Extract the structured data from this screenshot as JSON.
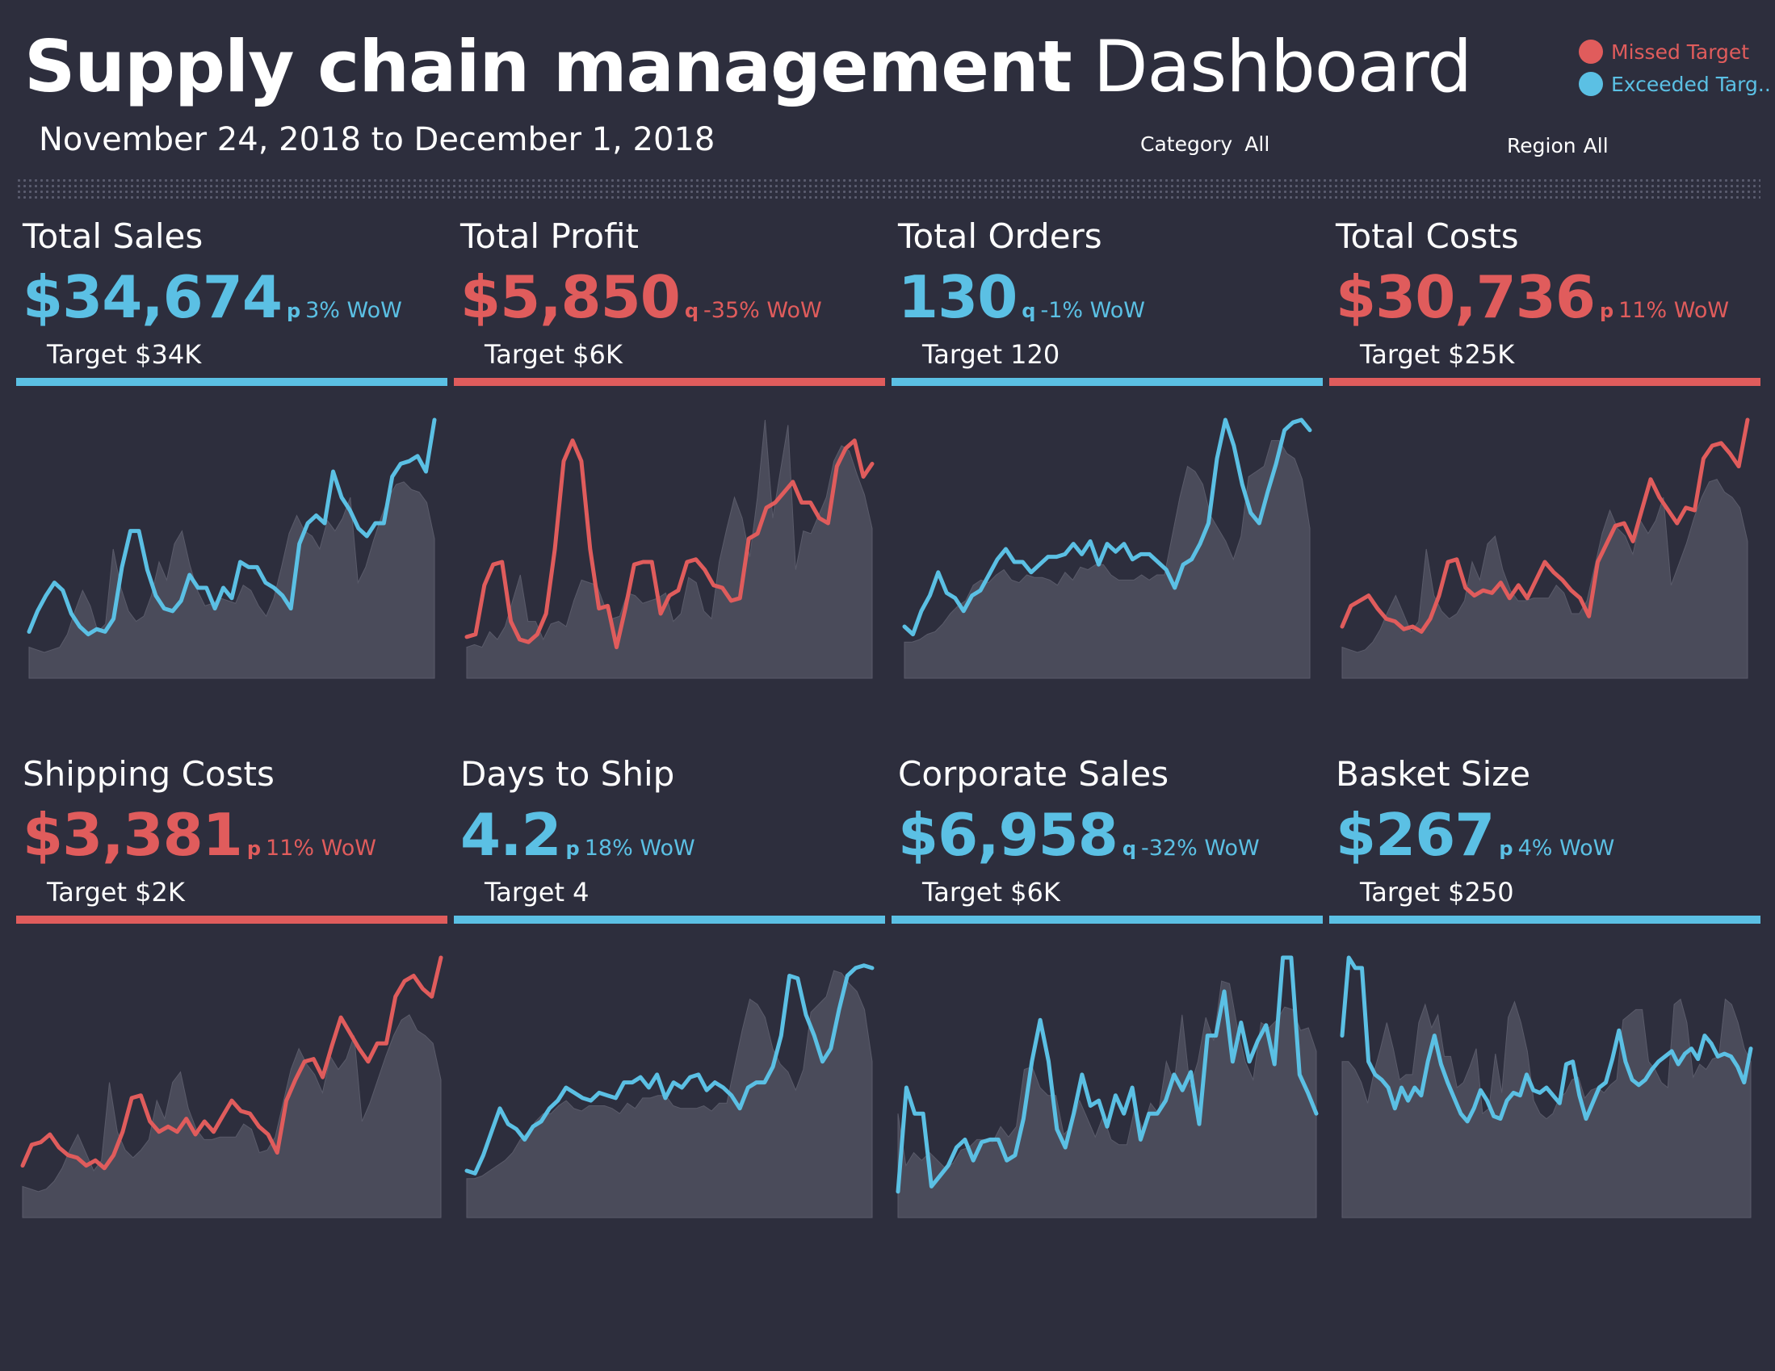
{
  "header": {
    "title_bold": "Supply chain management",
    "title_light": "Dashboard",
    "date_range": "November 24, 2018 to December 1, 2018",
    "category_label": "Category",
    "category_value": "All",
    "region_label": "Region",
    "region_value": "All"
  },
  "legend": [
    {
      "label": "Missed Target",
      "color": "#e05c5c"
    },
    {
      "label": "Exceeded Targ..",
      "color": "#5bc0e4"
    }
  ],
  "colors": {
    "missed": "#e05c5c",
    "exceeded": "#5bc0e4",
    "area": "#4a4b5a",
    "background": "#2d2e3d"
  },
  "kpis": [
    {
      "title": "Total Sales",
      "value": "$34,674",
      "arrow": "p",
      "change": "3% WoW",
      "target": "Target $34K",
      "status": "exceeded"
    },
    {
      "title": "Total Profit",
      "value": "$5,850",
      "arrow": "q",
      "change": "-35% WoW",
      "target": "Target $6K",
      "status": "missed"
    },
    {
      "title": "Total Orders",
      "value": "130",
      "arrow": "q",
      "change": "-1% WoW",
      "target": "Target 120",
      "status": "exceeded"
    },
    {
      "title": "Total Costs",
      "value": "$30,736",
      "arrow": "p",
      "change": "11% WoW",
      "target": "Target $25K",
      "status": "missed"
    },
    {
      "title": "Shipping Costs",
      "value": "$3,381",
      "arrow": "p",
      "change": "11% WoW",
      "target": "Target $2K",
      "status": "missed"
    },
    {
      "title": "Days to Ship",
      "value": "4.2",
      "arrow": "p",
      "change": "18% WoW",
      "target": "Target 4",
      "status": "exceeded"
    },
    {
      "title": "Corporate Sales",
      "value": "$6,958",
      "arrow": "q",
      "change": "-32% WoW",
      "target": "Target $6K",
      "status": "exceeded"
    },
    {
      "title": "Basket Size",
      "value": "$267",
      "arrow": "p",
      "change": "4% WoW",
      "target": "Target $250",
      "status": "exceeded"
    }
  ],
  "chart_data": [
    {
      "type": "line",
      "kpi": "Total Sales",
      "status": "exceeded",
      "line": [
        18,
        26,
        32,
        37,
        34,
        25,
        20,
        17,
        19,
        18,
        23,
        43,
        57,
        57,
        42,
        32,
        27,
        26,
        30,
        40,
        35,
        35,
        27,
        35,
        31,
        45,
        43,
        43,
        37,
        35,
        32,
        27,
        52,
        60,
        63,
        60,
        80,
        70,
        65,
        58,
        55,
        60,
        60,
        78,
        83,
        84,
        86,
        80,
        100
      ],
      "area": [
        12,
        11,
        10,
        11,
        12,
        17,
        26,
        34,
        28,
        18,
        21,
        50,
        35,
        26,
        22,
        24,
        32,
        45,
        38,
        52,
        57,
        44,
        34,
        28,
        29,
        31,
        30,
        29,
        36,
        34,
        28,
        24,
        31,
        43,
        56,
        63,
        57,
        55,
        50,
        61,
        57,
        62,
        70,
        37,
        43,
        53,
        62,
        70,
        75,
        76,
        73,
        72,
        68,
        54
      ]
    },
    {
      "type": "line",
      "kpi": "Total Profit",
      "status": "missed",
      "line": [
        16,
        17,
        36,
        44,
        45,
        22,
        15,
        14,
        17,
        25,
        50,
        84,
        92,
        84,
        50,
        27,
        28,
        12,
        27,
        44,
        45,
        45,
        25,
        32,
        34,
        45,
        46,
        42,
        36,
        35,
        30,
        31,
        54,
        56,
        66,
        68,
        72,
        76,
        68,
        68,
        62,
        60,
        82,
        89,
        92,
        78,
        83
      ],
      "area": [
        12,
        13,
        12,
        18,
        15,
        20,
        30,
        40,
        22,
        22,
        15,
        21,
        22,
        20,
        30,
        38,
        37,
        36,
        28,
        23,
        24,
        33,
        32,
        29,
        30,
        31,
        33,
        22,
        25,
        39,
        37,
        26,
        23,
        45,
        58,
        70,
        62,
        47,
        70,
        100,
        62,
        80,
        98,
        42,
        57,
        56,
        63,
        70,
        84,
        90,
        88,
        79,
        71,
        58
      ]
    },
    {
      "type": "line",
      "kpi": "Total Orders",
      "status": "exceeded",
      "line": [
        20,
        17,
        26,
        32,
        41,
        33,
        31,
        26,
        32,
        34,
        40,
        46,
        50,
        45,
        45,
        41,
        44,
        47,
        47,
        48,
        52,
        48,
        53,
        44,
        52,
        49,
        52,
        46,
        48,
        48,
        45,
        42,
        35,
        44,
        46,
        52,
        60,
        85,
        100,
        90,
        75,
        64,
        60,
        72,
        83,
        96,
        99,
        100,
        96
      ],
      "area": [
        14,
        14,
        15,
        17,
        18,
        21,
        25,
        28,
        30,
        36,
        38,
        37,
        40,
        42,
        38,
        37,
        40,
        39,
        39,
        38,
        36,
        41,
        38,
        43,
        42,
        44,
        44,
        40,
        38,
        38,
        38,
        40,
        38,
        40,
        40,
        55,
        70,
        82,
        80,
        75,
        63,
        58,
        53,
        46,
        55,
        78,
        80,
        82,
        92,
        92,
        87,
        85,
        77,
        58
      ]
    },
    {
      "type": "line",
      "kpi": "Total Costs",
      "status": "missed",
      "line": [
        20,
        28,
        30,
        32,
        27,
        23,
        22,
        19,
        20,
        18,
        23,
        32,
        45,
        46,
        35,
        32,
        34,
        33,
        37,
        31,
        36,
        31,
        38,
        45,
        41,
        38,
        34,
        31,
        24,
        45,
        52,
        59,
        60,
        53,
        65,
        77,
        70,
        65,
        60,
        66,
        65,
        85,
        90,
        91,
        87,
        82,
        100
      ],
      "area": [
        12,
        11,
        10,
        11,
        14,
        19,
        26,
        32,
        25,
        18,
        22,
        50,
        32,
        26,
        23,
        25,
        30,
        45,
        38,
        52,
        55,
        42,
        34,
        30,
        30,
        31,
        31,
        31,
        36,
        33,
        25,
        25,
        30,
        43,
        56,
        65,
        58,
        55,
        48,
        61,
        56,
        61,
        70,
        36,
        44,
        52,
        62,
        70,
        76,
        77,
        72,
        70,
        66,
        53
      ]
    },
    {
      "type": "line",
      "kpi": "Shipping Costs",
      "status": "missed",
      "line": [
        20,
        28,
        29,
        32,
        27,
        24,
        23,
        20,
        22,
        19,
        24,
        33,
        46,
        47,
        37,
        33,
        35,
        33,
        38,
        32,
        37,
        33,
        39,
        45,
        41,
        40,
        35,
        32,
        25,
        45,
        53,
        60,
        61,
        54,
        66,
        77,
        71,
        65,
        60,
        67,
        67,
        85,
        91,
        93,
        88,
        85,
        100
      ],
      "area": [
        12,
        11,
        10,
        11,
        14,
        19,
        26,
        32,
        25,
        18,
        22,
        52,
        33,
        26,
        23,
        26,
        30,
        45,
        38,
        52,
        56,
        42,
        34,
        30,
        30,
        31,
        31,
        31,
        36,
        34,
        25,
        26,
        31,
        44,
        57,
        65,
        59,
        55,
        48,
        62,
        57,
        61,
        70,
        37,
        44,
        53,
        62,
        70,
        76,
        78,
        72,
        70,
        67,
        53
      ]
    },
    {
      "type": "line",
      "kpi": "Days to Ship",
      "status": "exceeded",
      "line": [
        18,
        17,
        24,
        33,
        42,
        36,
        34,
        30,
        35,
        37,
        42,
        45,
        50,
        48,
        46,
        45,
        48,
        47,
        46,
        52,
        52,
        54,
        50,
        55,
        46,
        52,
        50,
        54,
        55,
        49,
        52,
        50,
        47,
        42,
        50,
        52,
        52,
        58,
        70,
        93,
        92,
        78,
        70,
        60,
        65,
        80,
        93,
        96,
        97,
        96
      ],
      "area": [
        15,
        15,
        16,
        18,
        20,
        22,
        25,
        30,
        33,
        37,
        40,
        40,
        43,
        45,
        42,
        41,
        43,
        43,
        43,
        42,
        40,
        44,
        42,
        46,
        46,
        47,
        47,
        43,
        42,
        42,
        42,
        43,
        41,
        44,
        44,
        58,
        72,
        84,
        82,
        77,
        65,
        59,
        56,
        49,
        57,
        79,
        82,
        85,
        95,
        94,
        90,
        87,
        80,
        60
      ]
    },
    {
      "type": "line",
      "kpi": "Corporate Sales",
      "status": "exceeded",
      "line": [
        10,
        50,
        40,
        40,
        12,
        16,
        20,
        27,
        30,
        22,
        29,
        30,
        30,
        22,
        24,
        38,
        60,
        76,
        60,
        34,
        27,
        40,
        55,
        43,
        45,
        35,
        47,
        40,
        50,
        30,
        40,
        40,
        45,
        55,
        49,
        56,
        36,
        70,
        70,
        87,
        60,
        75,
        60,
        68,
        74,
        59,
        100,
        100,
        55,
        48,
        40
      ],
      "area": [
        40,
        20,
        25,
        22,
        25,
        22,
        19,
        21,
        26,
        27,
        30,
        30,
        29,
        35,
        31,
        35,
        57,
        58,
        50,
        47,
        47,
        32,
        35,
        45,
        38,
        31,
        39,
        30,
        28,
        28,
        42,
        34,
        44,
        40,
        60,
        52,
        78,
        50,
        60,
        77,
        68,
        91,
        90,
        73,
        60,
        53,
        75,
        73,
        76,
        81,
        80,
        72,
        73,
        64
      ]
    },
    {
      "type": "line",
      "kpi": "Basket Size",
      "status": "exceeded",
      "line": [
        70,
        100,
        96,
        96,
        60,
        55,
        53,
        50,
        42,
        50,
        45,
        50,
        47,
        60,
        70,
        59,
        52,
        46,
        40,
        37,
        42,
        49,
        45,
        39,
        38,
        45,
        48,
        47,
        55,
        49,
        48,
        50,
        47,
        44,
        59,
        60,
        47,
        38,
        44,
        50,
        52,
        61,
        72,
        60,
        53,
        51,
        53,
        57,
        60,
        62,
        64,
        59,
        63,
        65,
        61,
        70,
        67,
        62,
        63,
        62,
        58,
        52,
        65
      ],
      "area": [
        60,
        60,
        57,
        52,
        44,
        56,
        65,
        75,
        65,
        53,
        55,
        55,
        75,
        82,
        73,
        78,
        62,
        62,
        50,
        52,
        58,
        65,
        40,
        42,
        63,
        48,
        77,
        83,
        75,
        64,
        45,
        40,
        38,
        40,
        46,
        48,
        53,
        54,
        46,
        49,
        50,
        48,
        51,
        53,
        76,
        78,
        80,
        80,
        60,
        57,
        52,
        50,
        82,
        84,
        75,
        54,
        59,
        57,
        61,
        62,
        84,
        82,
        75,
        65,
        60
      ]
    }
  ]
}
